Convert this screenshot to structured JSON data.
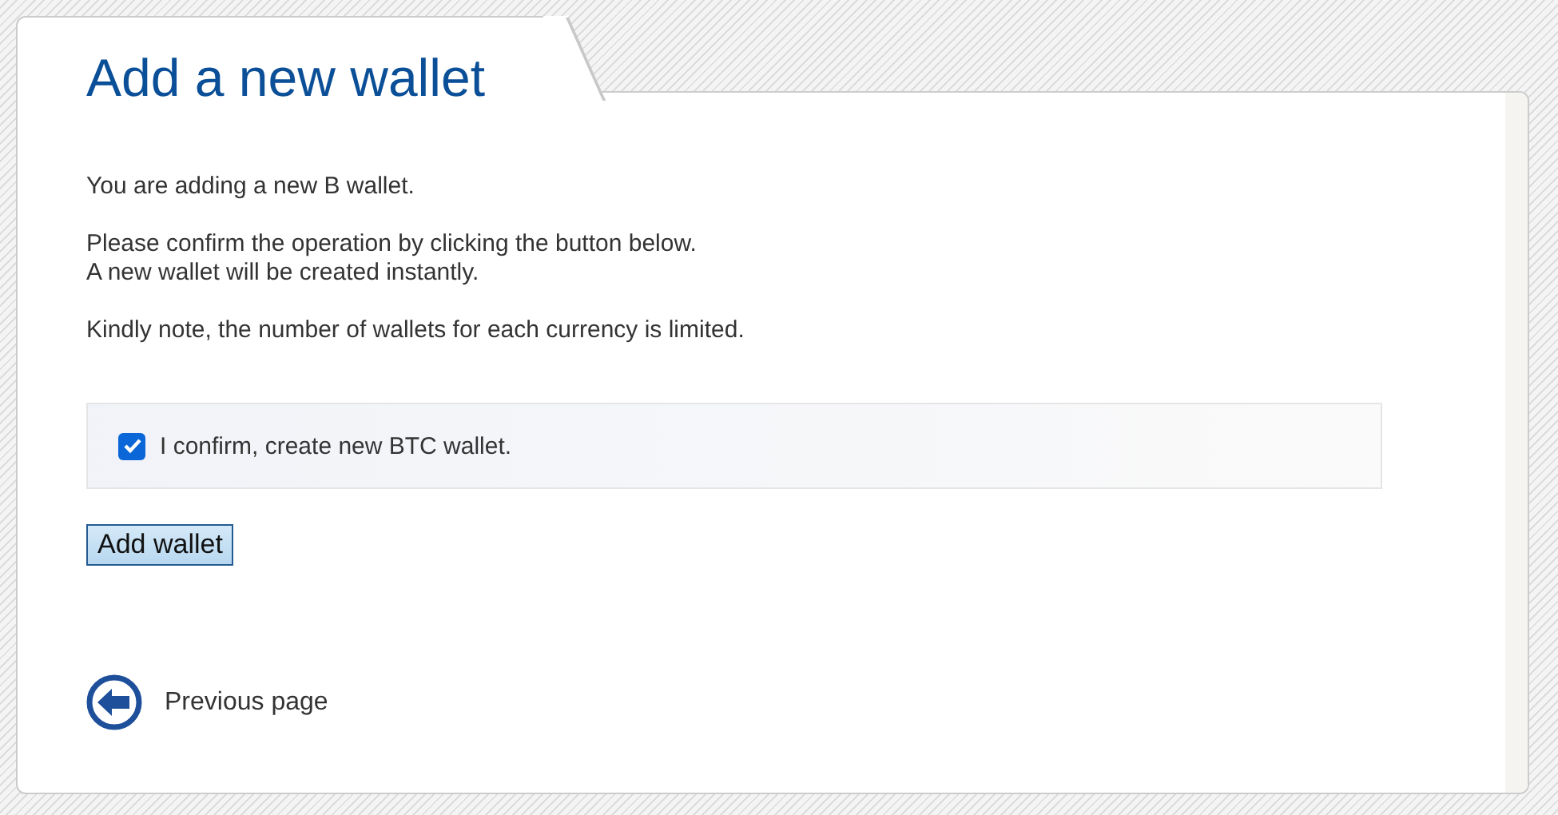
{
  "title": "Add a new wallet",
  "paragraphs": [
    {
      "lines": [
        "You are adding a new B wallet."
      ]
    },
    {
      "lines": [
        "Please confirm the operation by clicking the button below.",
        "A new wallet will be created instantly."
      ]
    },
    {
      "lines": [
        "Kindly note, the number of wallets for each currency is limited."
      ]
    }
  ],
  "confirm": {
    "label": "I confirm, create new BTC wallet.",
    "checked": true
  },
  "button": "Add wallet",
  "back_link": "Previous page"
}
